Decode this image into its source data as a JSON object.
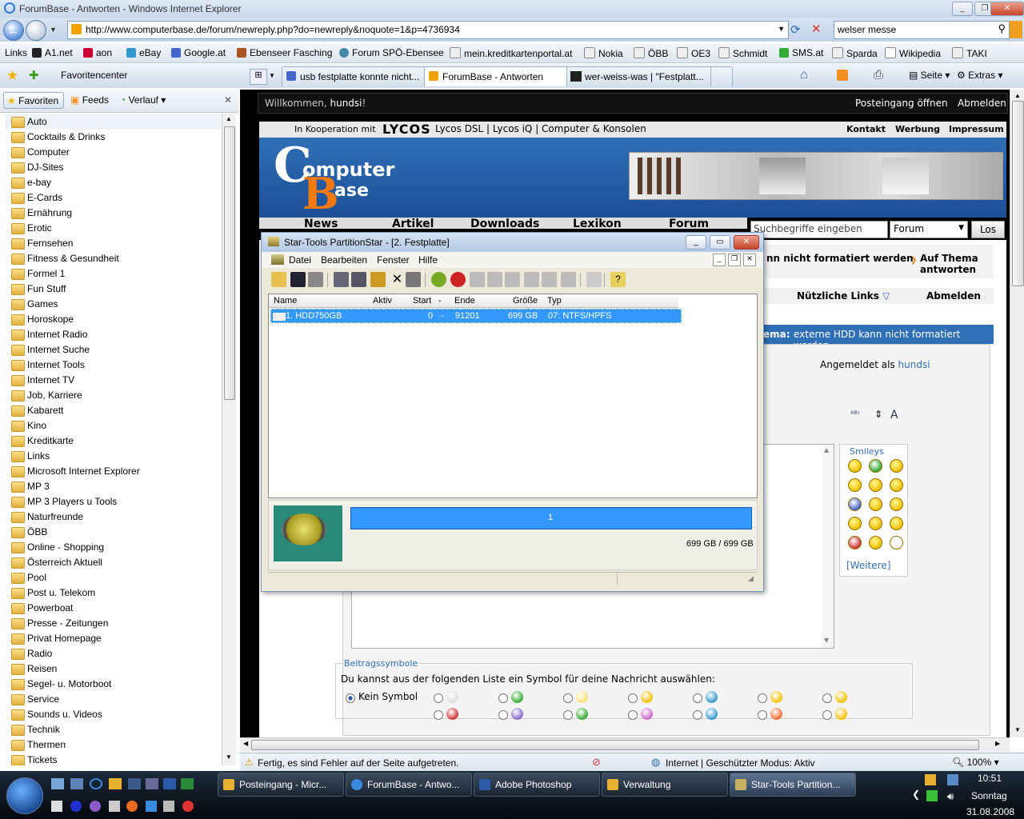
{
  "browser": {
    "window_title": "ForumBase - Antworten - Windows Internet Explorer",
    "url": "http://www.computerbase.de/forum/newreply.php?do=newreply&noquote=1&p=4736934",
    "search_value": "welser messe",
    "links_label": "Links",
    "links": [
      "A1.net",
      "aon",
      "eBay",
      "Google.at",
      "Ebenseer Fasching",
      "Forum SPÖ-Ebensee",
      "mein.kreditkartenportal.at",
      "Nokia",
      "ÖBB",
      "OE3",
      "Schmidt",
      "SMS.at",
      "Sparda",
      "Wikipedia",
      "TAKI"
    ],
    "favcenter_label": "Favoritencenter",
    "tabs": [
      {
        "label": "usb festplatte konnte nicht..."
      },
      {
        "label": "ForumBase - Antworten"
      },
      {
        "label": "wer-weiss-was | \"Festplatt..."
      }
    ],
    "toolbar": {
      "page": "Seite",
      "extras": "Extras"
    },
    "status_text": "Fertig, es sind Fehler auf der Seite aufgetreten.",
    "zone_text": "Internet | Geschützter Modus: Aktiv",
    "zoom": "100%"
  },
  "favorites": {
    "tabs": [
      "Favoriten",
      "Feeds",
      "Verlauf"
    ],
    "items": [
      "Auto",
      "Cocktails & Drinks",
      "Computer",
      "DJ-Sites",
      "e-bay",
      "E-Cards",
      "Ernährung",
      "Erotic",
      "Fernsehen",
      "Fitness & Gesundheit",
      "Formel 1",
      "Fun Stuff",
      "Games",
      "Horoskope",
      "Internet Radio",
      "Internet Suche",
      "Internet Tools",
      "Internet TV",
      "Job, Karriere",
      "Kabarett",
      "Kino",
      "Kreditkarte",
      "Links",
      "Microsoft Internet Explorer",
      "MP 3",
      "MP 3 Players u Tools",
      "Naturfreunde",
      "ÖBB",
      "Online - Shopping",
      "Österreich Aktuell",
      "Pool",
      "Post u. Telekom",
      "Powerboat",
      "Presse - Zeitungen",
      "Privat Homepage",
      "Radio",
      "Reisen",
      "Segel- u. Motorboot",
      "Service",
      "Sounds u. Videos",
      "Technik",
      "Thermen",
      "Tickets"
    ]
  },
  "site": {
    "welcome": "Willkommen,",
    "username": "hundsi",
    "welcome_end": "!",
    "inbox": "Posteingang öffnen",
    "logout": "Abmelden",
    "coop_text": "In Kooperation mit",
    "lycos": "LYCOS",
    "partner_links": "Lycos DSL | Lycos iQ | Computer & Konsolen",
    "top_links": [
      "Kontakt",
      "Werbung",
      "Impressum"
    ],
    "logo_line1": "omputer",
    "logo_line2": "ase",
    "nav": [
      "News",
      "Artikel",
      "Downloads",
      "Lexikon",
      "Forum"
    ],
    "search_placeholder": "Suchbegriffe eingeben",
    "search_scope": "Forum",
    "search_button": "Los",
    "thread_title_partial": "nn nicht formatiert werden",
    "reply_link": "Auf Thema antworten",
    "useful_links": "Nützliche Links",
    "logout2": "Abmelden",
    "topic_prefix": "ema:",
    "topic_title": "externe HDD kann nicht formatiert werden",
    "logged_in_as": "Angemeldet als",
    "smileys_title": "Smileys",
    "more": "[Weitere]",
    "post_icons_legend": "Beitragssymbole",
    "post_icons_hint": "Du kannst aus der folgenden Liste ein Symbol für deine Nachricht auswählen:",
    "no_symbol": "Kein Symbol"
  },
  "dialog": {
    "title": "Star-Tools PartitionStar - [2. Festplatte]",
    "menu": [
      "Datei",
      "Bearbeiten",
      "Fenster",
      "Hilfe"
    ],
    "columns": [
      "Name",
      "Aktiv",
      "Start",
      "-",
      "Ende",
      "Größe",
      "Typ"
    ],
    "row": {
      "name": "1. HDD750GB",
      "start": "0",
      "dash": "-",
      "end": "91201",
      "size": "699 GB",
      "type": "07: NTFS/HPFS"
    },
    "bar_label": "1",
    "capacity": "699 GB / 699 GB"
  },
  "taskbar": {
    "buttons": [
      "Posteingang - Micr...",
      "ForumBase - Antwo...",
      "Adobe Photoshop",
      "Verwaltung",
      "Star-Tools Partition..."
    ],
    "time": "10:51",
    "day": "Sonntag",
    "date": "31.08.2008"
  },
  "colors": {
    "accent": "#3399ff",
    "site_blue": "#2f6fb6",
    "selection": "#3399ff"
  }
}
